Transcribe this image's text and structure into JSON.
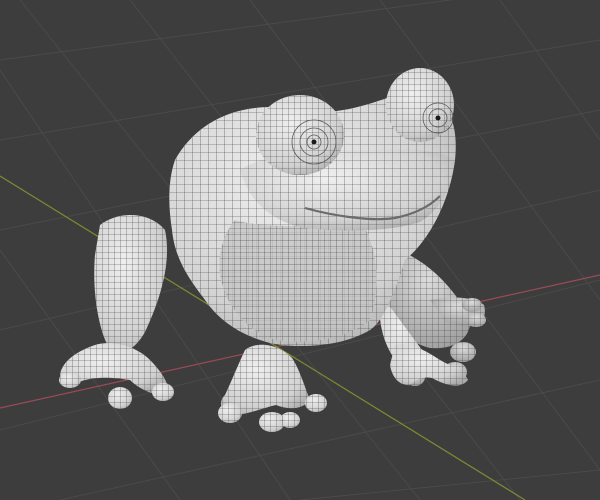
{
  "viewport": {
    "background_color": "#3d3d3d",
    "grid_color": "#4a4a4a",
    "x_axis_color": "#9a4a58",
    "y_axis_color": "#7b8a32"
  },
  "mesh": {
    "shading_color": "#dcdcdc",
    "shadow_color": "#a6a6a6",
    "wire_color": "#3a3a3a",
    "display_mode": "wireframe-overlay"
  }
}
